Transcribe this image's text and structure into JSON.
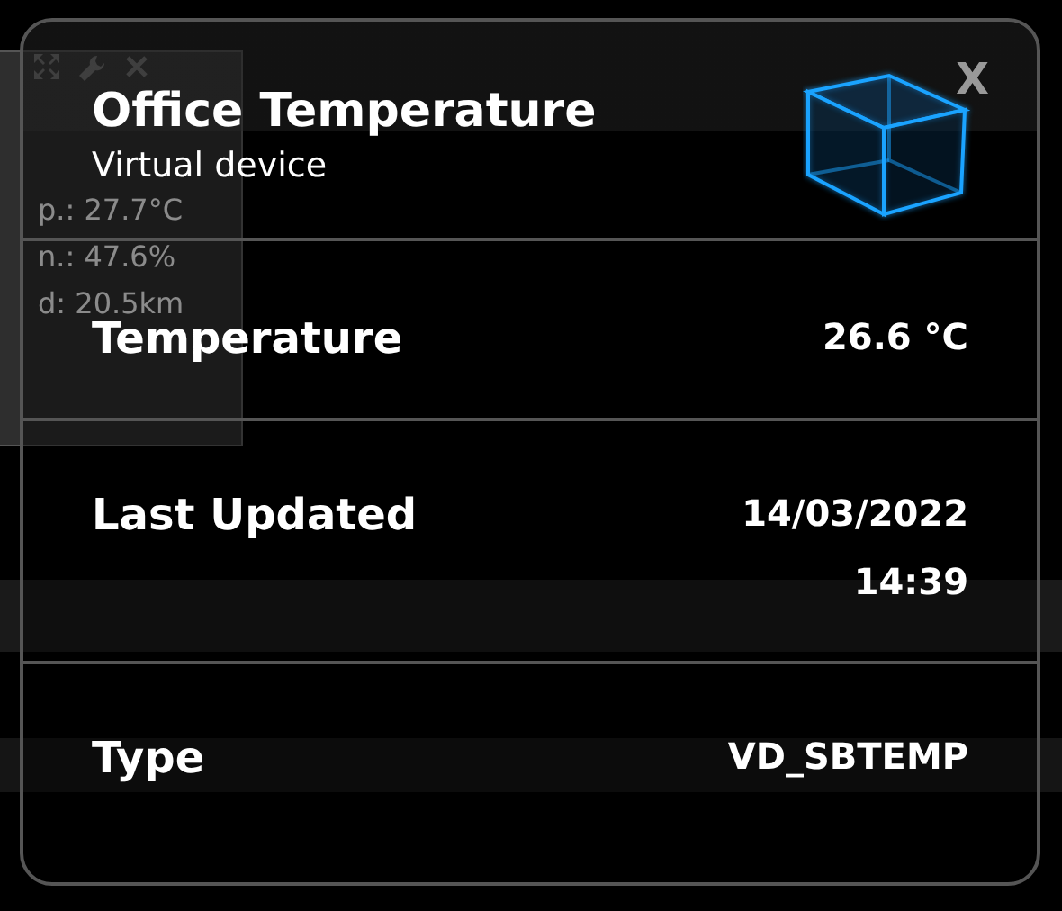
{
  "background_widget": {
    "lines": [
      "p.: 27.7°C",
      "n.: 47.6%",
      "d: 20.5km"
    ]
  },
  "dialog": {
    "title": "Office Temperature",
    "subtitle": "Virtual device",
    "close": "X",
    "rows": [
      {
        "label": "Temperature",
        "values": [
          "26.6 °C"
        ]
      },
      {
        "label": "Last Updated",
        "values": [
          "14/03/2022",
          "14:39"
        ]
      },
      {
        "label": "Type",
        "values": [
          "VD_SBTEMP"
        ]
      }
    ]
  }
}
